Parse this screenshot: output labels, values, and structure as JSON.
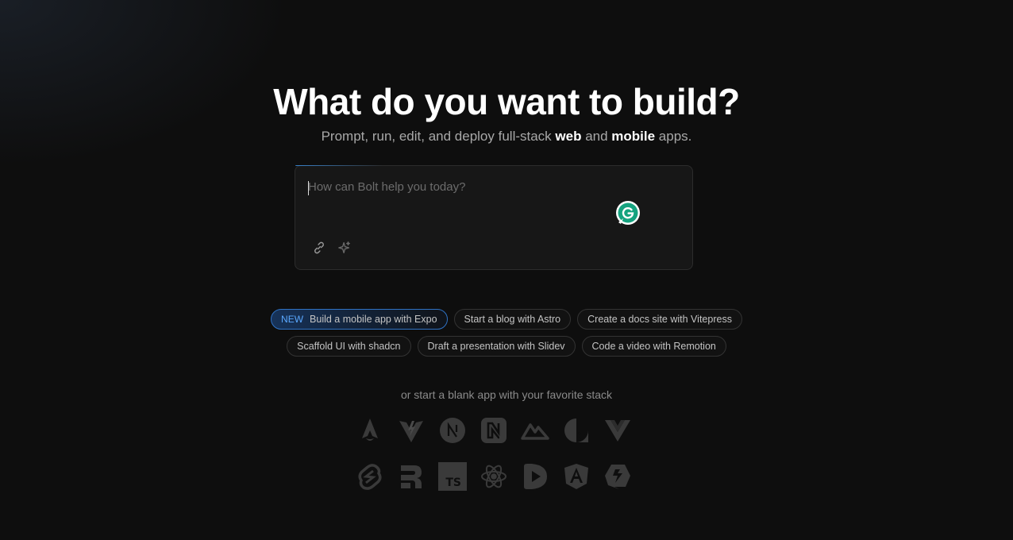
{
  "hero": {
    "title": "What do you want to build?",
    "subtitle_prefix": "Prompt, run, edit, and deploy full-stack ",
    "subtitle_web": "web",
    "subtitle_and": " and ",
    "subtitle_mobile": "mobile",
    "subtitle_suffix": " apps."
  },
  "prompt": {
    "placeholder": "How can Bolt help you today?",
    "value": "",
    "tools": [
      "link-icon",
      "sparkle-icon"
    ],
    "extension_icon": "grammarly-icon"
  },
  "suggestions": {
    "row1": [
      {
        "tag": "NEW",
        "label": "Build a mobile app with Expo"
      },
      {
        "label": "Start a blog with Astro"
      },
      {
        "label": "Create a docs site with Vitepress"
      }
    ],
    "row2": [
      {
        "label": "Scaffold UI with shadcn"
      },
      {
        "label": "Draft a presentation with Slidev"
      },
      {
        "label": "Code a video with Remotion"
      }
    ]
  },
  "stacks": {
    "label": "or start a blank app with your favorite stack",
    "row1": [
      "astro-icon",
      "vite-icon",
      "nextjs-icon",
      "nuxt-icon",
      "nuxt-alt-icon",
      "analog-icon",
      "vue-icon"
    ],
    "row2": [
      "svelte-icon",
      "remix-icon",
      "typescript-icon",
      "react-icon",
      "slidev-icon",
      "angular-icon",
      "qwik-icon"
    ]
  },
  "colors": {
    "background": "#0e0e0e",
    "accent": "#2f72c4",
    "new_tag": "#5aa8ff",
    "icon_gray": "#3a3a3a"
  }
}
